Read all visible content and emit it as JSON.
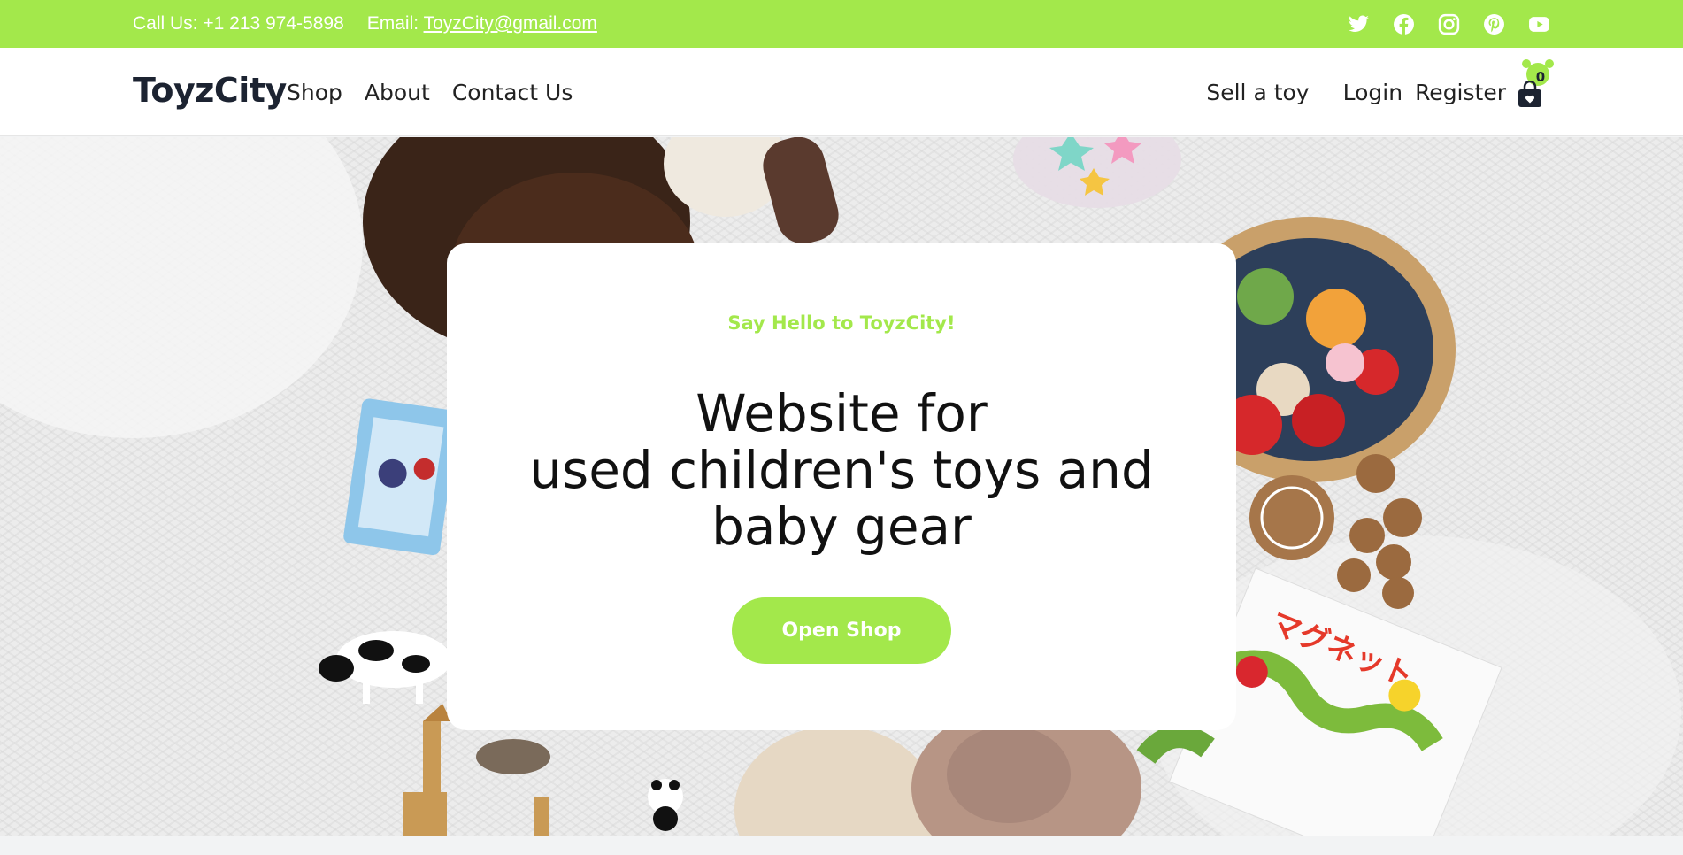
{
  "topbar": {
    "phone": "Call Us: +1 213 974-5898",
    "email_label": "Email: ",
    "email": "ToyzCity@gmail.com",
    "socials": [
      "twitter-icon",
      "facebook-icon",
      "instagram-icon",
      "pinterest-icon",
      "youtube-icon"
    ]
  },
  "nav": {
    "brand": "ToyzCity",
    "links": [
      "Shop",
      "About",
      "Contact Us"
    ],
    "sell": "Sell a toy",
    "login": "Login",
    "register": "Register",
    "cart_count": "0"
  },
  "hero": {
    "tagline": "Say Hello to ToyzCity!",
    "headline": [
      "Website for",
      "used children's toys and",
      "baby gear"
    ],
    "cta": "Open Shop"
  },
  "colors": {
    "accent": "#a3e84b",
    "dark": "#1c2331"
  }
}
